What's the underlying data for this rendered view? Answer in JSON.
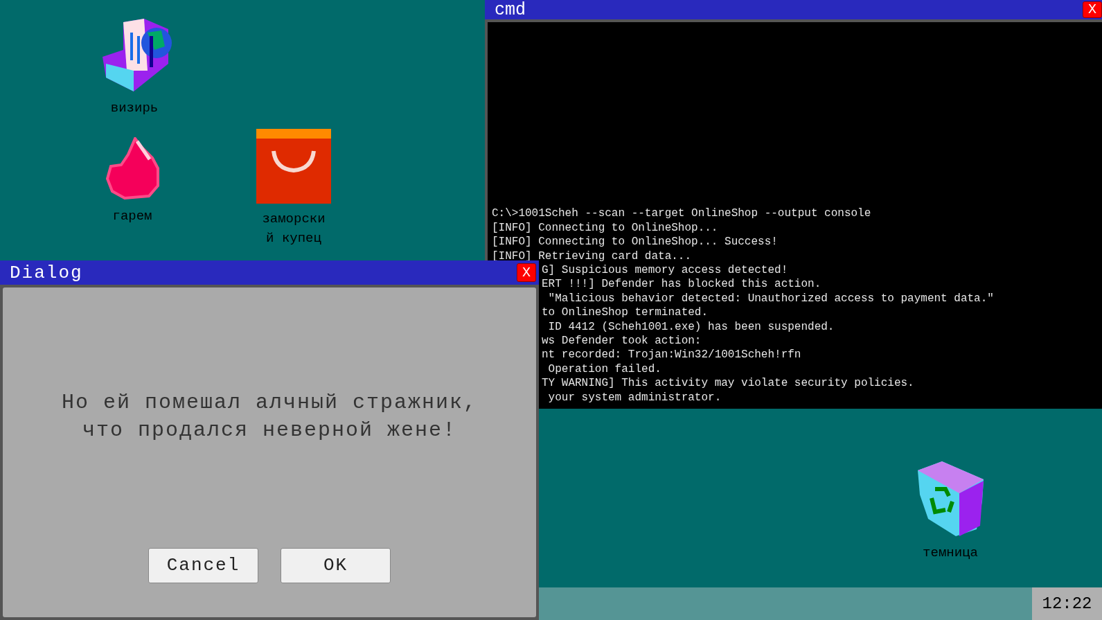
{
  "desktop_icons": [
    {
      "kind": "vizier",
      "label": "визирь"
    },
    {
      "kind": "harem",
      "label": "гарем"
    },
    {
      "kind": "merchant",
      "label": "заморски\nй купец"
    },
    {
      "kind": "dungeon",
      "label": "темница"
    }
  ],
  "cmd": {
    "title": "cmd",
    "close": "X",
    "lines": [
      "C:\\>1001Scheh --scan --target OnlineShop --output console",
      "[INFO] Connecting to OnlineShop...",
      "[INFO] Connecting to OnlineShop... Success!",
      "[INFO] Retrieving card data..."
    ],
    "lines_partly_hidden": [
      "G] Suspicious memory access detected!",
      "ERT !!!] Defender has blocked this action.",
      " \"Malicious behavior detected: Unauthorized access to payment data.\"",
      "to OnlineShop terminated.",
      " ID 4412 (Scheh1001.exe) has been suspended.",
      "ws Defender took action:",
      "nt recorded: Trojan:Win32/1001Scheh!rfn",
      " Operation failed.",
      "TY WARNING] This activity may violate security policies.",
      " your system administrator."
    ]
  },
  "dialog": {
    "title": "Dialog",
    "close": "X",
    "message": "Но ей помешал алчный стражник,\nчто продался неверной жене!",
    "buttons": [
      "Cancel",
      "OK"
    ]
  },
  "taskbar": {
    "clock": "12:22"
  }
}
